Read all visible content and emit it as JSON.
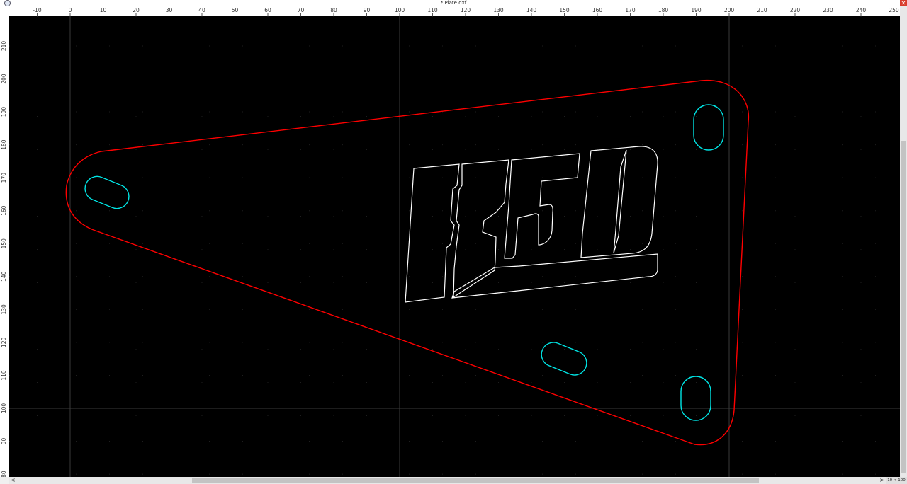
{
  "window": {
    "title": "* Plate.dxf",
    "close_glyph": "✕",
    "app_icon": "search-icon"
  },
  "rulers": {
    "x_ticks": [
      "-10",
      "0",
      "10",
      "20",
      "30",
      "40",
      "50",
      "60",
      "70",
      "80",
      "90",
      "100",
      "110",
      "120",
      "130",
      "140",
      "150",
      "160",
      "170",
      "180",
      "190",
      "200",
      "210",
      "220",
      "230",
      "240",
      "250"
    ],
    "y_ticks": [
      "210",
      "200",
      "190",
      "180",
      "170",
      "160",
      "150",
      "140",
      "130",
      "120",
      "110",
      "100",
      "90",
      "80"
    ]
  },
  "drawing": {
    "plate_outline_color": "#ff0000",
    "slot_color": "#00e5e5",
    "text_outline_color": "#ffffff",
    "grid_color": "#3a3a3a",
    "logo_text": "R50"
  },
  "statusbar": {
    "zoom_text": "10 < 100"
  },
  "scrollbars": {
    "left_arrow": "<",
    "right_arrow": ">"
  }
}
